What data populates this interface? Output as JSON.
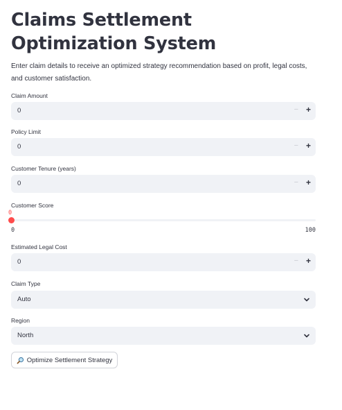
{
  "page": {
    "title": "Claims Settlement Optimization System",
    "description": "Enter claim details to receive an optimized strategy recommendation based on profit, legal costs, and customer satisfaction."
  },
  "fields": {
    "claim_amount": {
      "label": "Claim Amount",
      "value": "0",
      "minus": "−",
      "plus": "+"
    },
    "policy_limit": {
      "label": "Policy Limit",
      "value": "0",
      "minus": "−",
      "plus": "+"
    },
    "customer_tenure": {
      "label": "Customer Tenure (years)",
      "value": "0",
      "minus": "−",
      "plus": "+"
    },
    "customer_score": {
      "label": "Customer Score",
      "value": "0",
      "min": "0",
      "max": "100",
      "level": 0
    },
    "legal_cost": {
      "label": "Estimated Legal Cost",
      "value": "0",
      "minus": "−",
      "plus": "+"
    },
    "claim_type": {
      "label": "Claim Type",
      "selected": "Auto"
    },
    "region": {
      "label": "Region",
      "selected": "North"
    }
  },
  "actions": {
    "optimize_button": {
      "label": "Optimize Settlement Strategy",
      "icon": "magnifier-icon"
    }
  },
  "colors": {
    "accent": "#ff4b4b",
    "input_bg": "#f0f2f6",
    "text": "#31333f"
  }
}
